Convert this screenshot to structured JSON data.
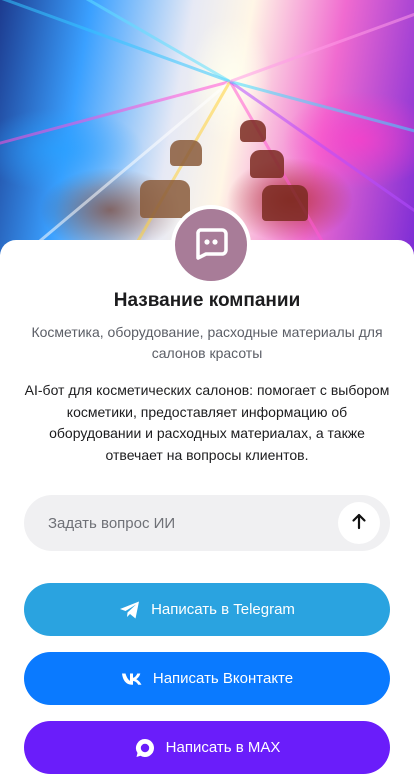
{
  "company": {
    "name": "Название компании",
    "subtitle": "Косметика, оборудование, расходные материалы для салонов красоты",
    "description": "AI-бот для косметических салонов: помогает с выбором косметики, предоставляет информацию об оборудовании и расходных материалах, а также отвечает на вопросы клиентов."
  },
  "ask": {
    "placeholder": "Задать вопрос ИИ",
    "value": ""
  },
  "buttons": {
    "telegram": "Написать в Telegram",
    "vk": "Написать Вконтакте",
    "max": "Написать в MAX"
  },
  "icons": {
    "avatar": "chat-bot-icon",
    "send": "arrow-up-icon",
    "telegram": "telegram-icon",
    "vk": "vk-icon",
    "max": "max-icon"
  },
  "colors": {
    "avatar": "#a87c98",
    "telegram": "#2aa3e0",
    "vk": "#0a7aff",
    "max": "#6a1dfa",
    "input_bg": "#f0f0f2"
  }
}
